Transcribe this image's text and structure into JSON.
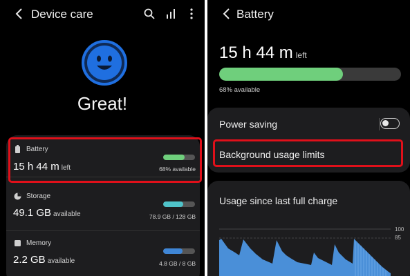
{
  "left": {
    "title": "Device care",
    "status": "Great!",
    "battery": {
      "label": "Battery",
      "value": "15 h 44 m",
      "unit": "left",
      "detail": "68% available",
      "level": 0.68
    },
    "storage": {
      "label": "Storage",
      "value": "49.1 GB",
      "unit": "available",
      "detail": "78.9 GB / 128 GB",
      "level": 0.62
    },
    "memory": {
      "label": "Memory",
      "value": "2.2 GB",
      "unit": "available",
      "detail": "4.8 GB / 8 GB",
      "level": 0.6
    }
  },
  "right": {
    "title": "Battery",
    "time_value": "15 h 44 m",
    "time_unit": "left",
    "available": "68% available",
    "level": 0.68,
    "power_saving": "Power saving",
    "power_saving_on": false,
    "background_limits": "Background usage limits",
    "usage_title": "Usage since last full charge",
    "chart_ticks": [
      "100",
      "85"
    ]
  },
  "colors": {
    "accent_green": "#6fcf7c",
    "storage_teal": "#4fc3c9",
    "memory_blue": "#3f86d6",
    "highlight_red": "#e0101a",
    "face_blue": "#1f6fe0"
  }
}
